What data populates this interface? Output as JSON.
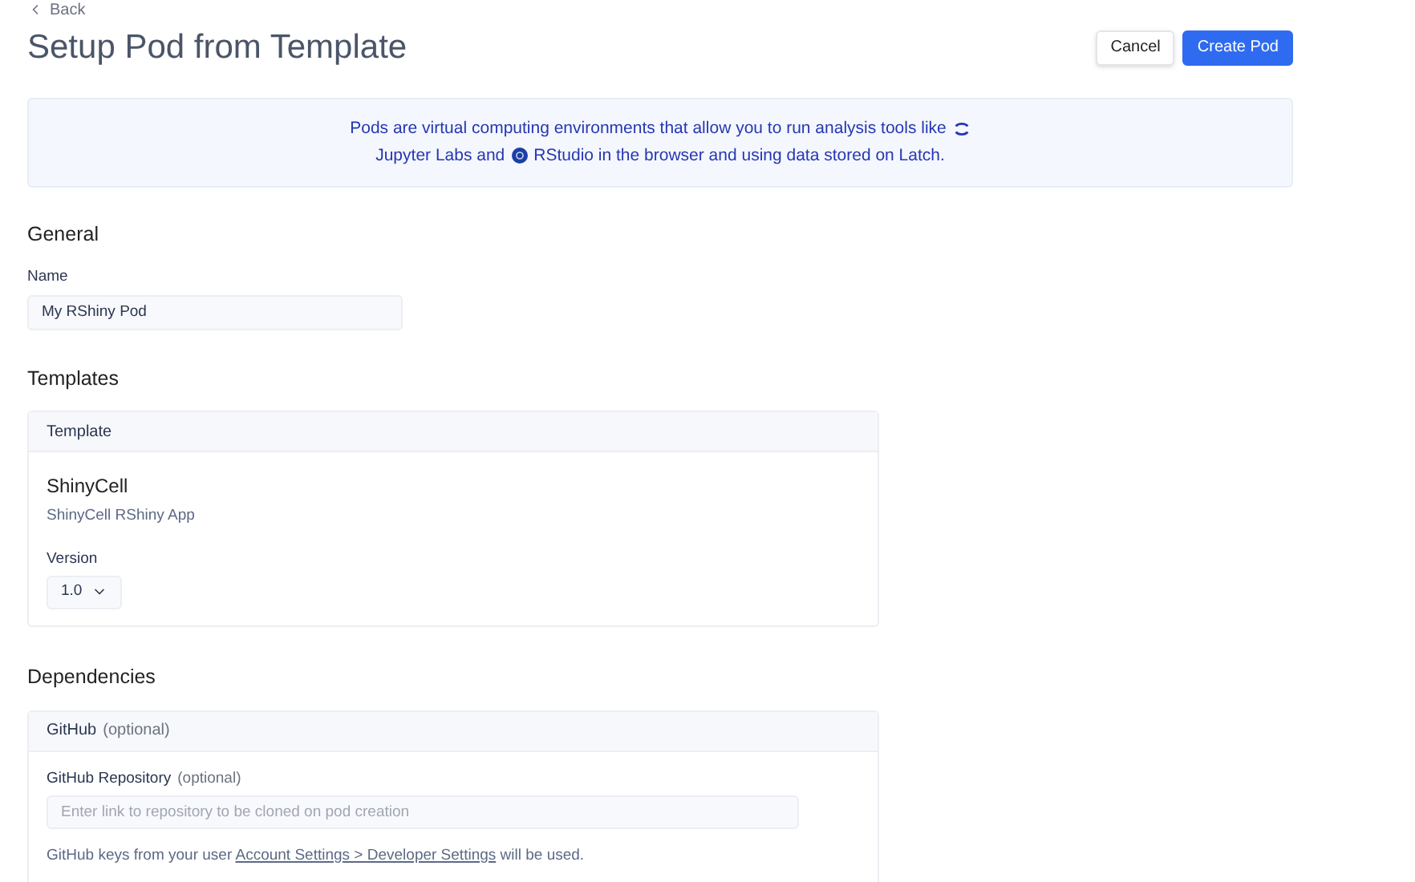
{
  "back_link": "Back",
  "title": "Setup Pod from Template",
  "buttons": [
    {
      "label": "Cancel",
      "kind": "secondary"
    },
    {
      "label": "Create Pod",
      "kind": "primary"
    }
  ],
  "info": {
    "line_1": "Pods are virtual computing environments that allow you to run analysis tools like",
    "line_2_start": "Jupyter Labs and",
    "line_2_end": "RStudio in the browser and using data stored on Latch."
  },
  "general": {
    "heading": "General",
    "name_label": "Name",
    "name_value": "My RShiny Pod"
  },
  "templates": {
    "heading": "Templates",
    "card_header": "Template",
    "template_name": "ShinyCell",
    "template_description": "ShinyCell RShiny App",
    "version_label": "Version",
    "version_value": "1.0"
  },
  "dependencies": {
    "heading": "Dependencies",
    "card_header": "GitHub",
    "card_header_note": "(optional)",
    "repo_label": "GitHub Repository",
    "repo_note": "(optional)",
    "repo_placeholder": "Enter link to repository to be cloned on pod creation",
    "hint_start": "GitHub keys from your user",
    "hint_link": "Account Settings > Developer Settings",
    "hint_end": "will be used."
  }
}
